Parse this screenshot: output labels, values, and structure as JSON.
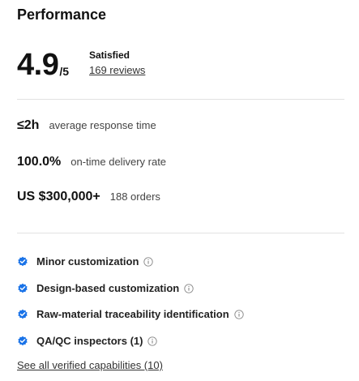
{
  "section": {
    "title": "Performance"
  },
  "rating": {
    "score": "4.9",
    "max": "/5",
    "sentiment": "Satisfied",
    "reviews_link": "169 reviews"
  },
  "stats": [
    {
      "value": "≤2h",
      "label": "average response time"
    },
    {
      "value": "100.0%",
      "label": "on-time delivery rate"
    },
    {
      "value": "US $300,000+",
      "label": "188 orders"
    }
  ],
  "capabilities": {
    "items": [
      {
        "label": "Minor customization",
        "icon": "verified-check-icon",
        "info_icon": "info-icon"
      },
      {
        "label": "Design-based customization",
        "icon": "verified-check-icon",
        "info_icon": "info-icon"
      },
      {
        "label": "Raw-material traceability identification",
        "icon": "verified-check-icon",
        "info_icon": "info-icon"
      },
      {
        "label": "QA/QC inspectors (1)",
        "icon": "verified-check-icon",
        "info_icon": "info-icon"
      }
    ],
    "see_all_link": "See all verified capabilities (10)"
  },
  "colors": {
    "verified_badge": "#1a73e8",
    "divider": "#e2e2e2",
    "text_primary": "#111111",
    "text_secondary": "#444444"
  }
}
